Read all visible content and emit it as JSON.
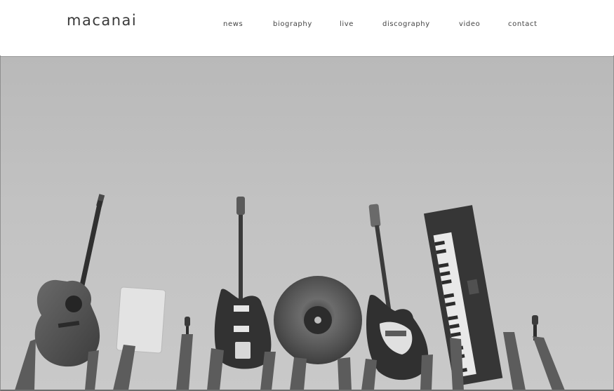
{
  "brand": {
    "logo_text": "macanai"
  },
  "nav": {
    "items": [
      {
        "label": "news"
      },
      {
        "label": "biography"
      },
      {
        "label": "live"
      },
      {
        "label": "discography"
      },
      {
        "label": "video"
      },
      {
        "label": "contact"
      }
    ]
  },
  "hero": {
    "image": "band-instruments-raised-photo",
    "colors": {
      "sky": "#c2c2c2",
      "instrument_dark": "#3c3c3c",
      "skin": "#6a6a6a"
    }
  }
}
